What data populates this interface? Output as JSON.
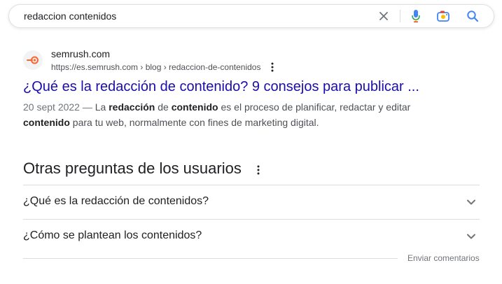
{
  "search": {
    "query": "redaccion contenidos",
    "icons": [
      "close-icon",
      "microphone-icon",
      "lens-camera-icon",
      "search-icon"
    ]
  },
  "result": {
    "site_name": "semrush.com",
    "url": "https://es.semrush.com › blog › redaccion-de-contenidos",
    "title": "¿Qué es la redacción de contenido? 9 consejos para publicar ...",
    "snippet": {
      "date": "20 sept 2022",
      "separator": " — ",
      "parts": [
        {
          "text": "La ",
          "bold": false
        },
        {
          "text": "redacción",
          "bold": true
        },
        {
          "text": " de ",
          "bold": false
        },
        {
          "text": "contenido",
          "bold": true
        },
        {
          "text": " es el proceso de planificar, redactar y editar ",
          "bold": false
        },
        {
          "text": "contenido",
          "bold": true
        },
        {
          "text": " para tu web, normalmente con fines de marketing digital.",
          "bold": false
        }
      ]
    }
  },
  "paa": {
    "title": "Otras preguntas de los usuarios",
    "questions": [
      "¿Qué es la redacción de contenidos?",
      "¿Cómo se plantean los contenidos?"
    ],
    "feedback": "Enviar comentarios"
  },
  "colors": {
    "link": "#1a0dab",
    "text": "#202124",
    "secondary": "#4d5156",
    "divider": "#dadce0",
    "brand_semrush": "#ff642d",
    "google_blue": "#4285f4"
  }
}
